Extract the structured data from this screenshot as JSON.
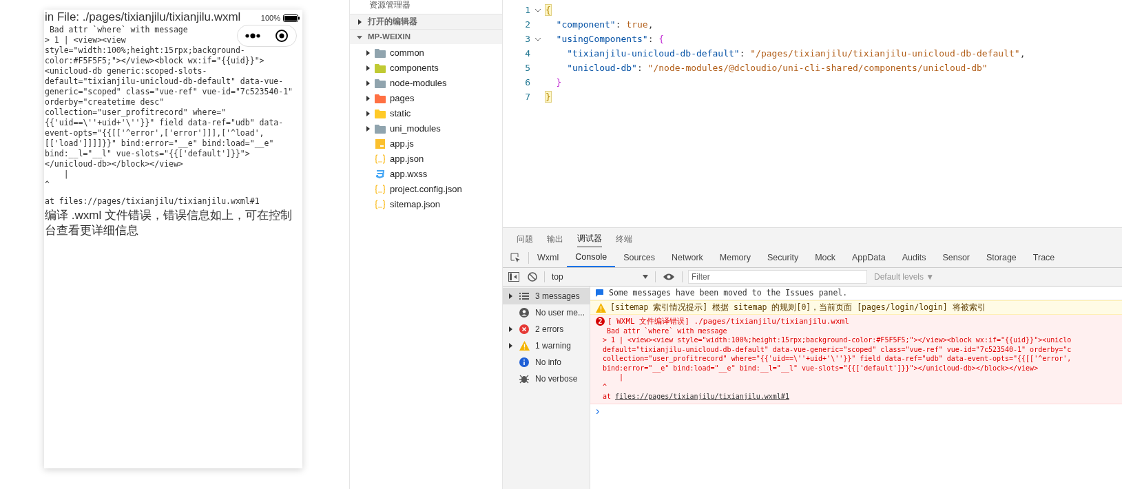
{
  "phone": {
    "battery_text": "100%",
    "file_line": "in File: ./pages/tixianjilu/tixianjilu.wxml",
    "code_lines": [
      " Bad attr `where` with message",
      "> 1 | <view><view",
      "style=\"width:100%;height:15rpx;background-",
      "color:#F5F5F5;\"></view><block wx:if=\"{{uid}}\">",
      "<unicloud-db generic:scoped-slots-",
      "default=\"tixianjilu-unicloud-db-default\" data-vue-",
      "generic=\"scoped\" class=\"vue-ref\" vue-id=\"7c523540-1\"",
      "orderby=\"createtime desc\"",
      "collection=\"user_profitrecord\" where=\"",
      "{{'uid==\\''+uid+'\\''}}\" field data-ref=\"udb\" data-",
      "event-opts=\"{{[['^error',['error']]],['^load',",
      "[['load']]]]}}\" bind:error=\"__e\" bind:load=\"__e\"",
      "bind:__l=\"__l\" vue-slots=\"{{['default']}}\">",
      "</unicloud-db></block></view>",
      "    |",
      "^"
    ],
    "at_line": "at files://pages/tixianjilu/tixianjilu.wxml#1",
    "message": "编译 .wxml 文件错误，错误信息如上，可在控制台查看更详细信息"
  },
  "explorer": {
    "title": "资源管理器",
    "sections": [
      {
        "label": "打开的编辑器",
        "expanded": false
      },
      {
        "label": "MP-WEIXIN",
        "expanded": true
      }
    ],
    "items": [
      {
        "name": "common",
        "kind": "folder",
        "color": "#90a4ae"
      },
      {
        "name": "components",
        "kind": "folder",
        "color": "#c0ca33"
      },
      {
        "name": "node-modules",
        "kind": "folder",
        "color": "#90a4ae"
      },
      {
        "name": "pages",
        "kind": "folder",
        "color": "#ff7043"
      },
      {
        "name": "static",
        "kind": "folder",
        "color": "#ffca28"
      },
      {
        "name": "uni_modules",
        "kind": "folder",
        "color": "#90a4ae"
      },
      {
        "name": "app.js",
        "kind": "js"
      },
      {
        "name": "app.json",
        "kind": "json"
      },
      {
        "name": "app.wxss",
        "kind": "css"
      },
      {
        "name": "project.config.json",
        "kind": "json"
      },
      {
        "name": "sitemap.json",
        "kind": "json"
      }
    ]
  },
  "editor": {
    "lines": [
      {
        "number": "1",
        "foldable": true,
        "tokens": [
          {
            "text": "{",
            "kind": "outer"
          }
        ],
        "children": [
          {
            "number": "2",
            "tokens": [
              {
                "text": "\"component\"",
                "kind": "key"
              },
              {
                "text": ": ",
                "kind": "punct"
              },
              {
                "text": "true",
                "kind": "value"
              },
              {
                "text": ",",
                "kind": "punct"
              }
            ]
          },
          {
            "number": "3",
            "foldable": true,
            "tokens": [
              {
                "text": "\"usingComponents\"",
                "kind": "key"
              },
              {
                "text": ": ",
                "kind": "punct"
              },
              {
                "text": "{",
                "kind": "inner"
              }
            ],
            "children": [
              {
                "number": "4",
                "tokens": [
                  {
                    "text": "\"tixianjilu-unicloud-db-default\"",
                    "kind": "key"
                  },
                  {
                    "text": ": ",
                    "kind": "punct"
                  },
                  {
                    "text": "\"/pages/tixianjilu/tixianjilu-unicloud-db-default\"",
                    "kind": "value"
                  },
                  {
                    "text": ",",
                    "kind": "punct"
                  }
                ]
              },
              {
                "number": "5",
                "tokens": [
                  {
                    "text": "\"unicloud-db\"",
                    "kind": "key"
                  },
                  {
                    "text": ": ",
                    "kind": "punct"
                  },
                  {
                    "text": "\"/node-modules/@dcloudio/uni-cli-shared/components/unicloud-db\"",
                    "kind": "value"
                  }
                ]
              }
            ]
          },
          {
            "number": "6",
            "tokens": [
              {
                "text": "}",
                "kind": "inner"
              }
            ]
          }
        ]
      },
      {
        "number": "7",
        "tokens": [
          {
            "text": "}",
            "kind": "outer"
          }
        ]
      }
    ]
  },
  "panel": {
    "tabs": [
      {
        "label": "问题",
        "selected": false
      },
      {
        "label": "输出",
        "selected": false
      },
      {
        "label": "调试器",
        "selected": true
      },
      {
        "label": "终端",
        "selected": false
      }
    ],
    "devtools_tabs": [
      {
        "label": "Wxml",
        "selected": false
      },
      {
        "label": "Console",
        "selected": true
      },
      {
        "label": "Sources",
        "selected": false
      },
      {
        "label": "Network",
        "selected": false
      },
      {
        "label": "Memory",
        "selected": false
      },
      {
        "label": "Security",
        "selected": false
      },
      {
        "label": "Mock",
        "selected": false
      },
      {
        "label": "AppData",
        "selected": false
      },
      {
        "label": "Audits",
        "selected": false
      },
      {
        "label": "Sensor",
        "selected": false
      },
      {
        "label": "Storage",
        "selected": false
      },
      {
        "label": "Trace",
        "selected": false
      }
    ],
    "context": "top",
    "filter_placeholder": "Filter",
    "levels": "Default levels ▼",
    "sidebar": [
      {
        "label": "3 messages",
        "kind": "list",
        "expandable": true,
        "selected": true
      },
      {
        "label": "No user me...",
        "kind": "user",
        "expandable": false,
        "selected": false
      },
      {
        "label": "2 errors",
        "kind": "error",
        "expandable": true,
        "selected": false
      },
      {
        "label": "1 warning",
        "kind": "warning",
        "expandable": true,
        "selected": false
      },
      {
        "label": "No info",
        "kind": "info",
        "expandable": false,
        "selected": false
      },
      {
        "label": "No verbose",
        "kind": "verbose",
        "expandable": false,
        "selected": false
      }
    ],
    "messages": [
      {
        "kind": "info",
        "text": "Some messages have been moved to the Issues panel."
      },
      {
        "kind": "warning",
        "text": "[sitemap 索引情况提示] 根据 sitemap 的规则[0]，当前页面 [pages/login/login] 将被索引"
      },
      {
        "kind": "error",
        "count": "2",
        "text": "[ WXML 文件编译错误] ./pages/tixianjilu/tixianjilu.wxml",
        "lines": [
          " Bad attr `where` with message",
          "> 1 | <view><view style=\"width:100%;height:15rpx;background-color:#F5F5F5;\"></view><block wx:if=\"{{uid}}\"><uniclo",
          "default=\"tixianjilu-unicloud-db-default\" data-vue-generic=\"scoped\" class=\"vue-ref\" vue-id=\"7c523540-1\" orderby=\"c",
          "collection=\"user_profitrecord\" where=\"{{'uid==\\''+uid+'\\''}}\" field data-ref=\"udb\" data-event-opts=\"{{[['^error',",
          "bind:error=\"__e\" bind:load=\"__e\" bind:__l=\"__l\" vue-slots=\"{{['default']}}\"></unicloud-db></block></view>",
          "    |",
          "^"
        ],
        "at_prefix": "at",
        "link": "files://pages/tixianjilu/tixianjilu.wxml#1"
      }
    ],
    "prompt": "›"
  }
}
